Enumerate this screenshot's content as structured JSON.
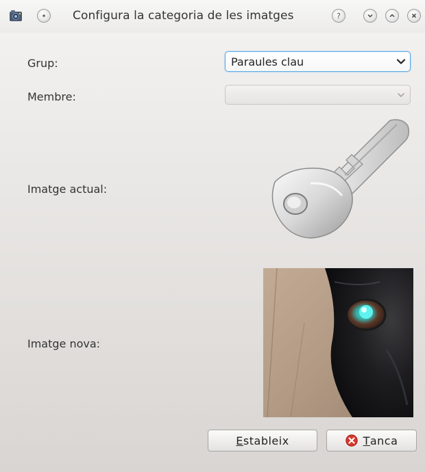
{
  "window": {
    "title": "Configura la categoria de les imatges",
    "icons": [
      "app-icon",
      "sticky-icon",
      "help-icon",
      "minimize-icon",
      "maximize-icon",
      "close-icon"
    ],
    "help_glyph": "?"
  },
  "form": {
    "group_label": "Grup:",
    "group_value": "Paraules clau",
    "member_label": "Membre:",
    "member_value": "",
    "current_image_label": "Imatge actual:",
    "new_image_label": "Imatge nova:"
  },
  "buttons": {
    "set_mnemonic": "E",
    "set_rest": "stableix",
    "close_mnemonic": "T",
    "close_rest": "anca"
  },
  "colors": {
    "focus_border": "#5aa9e6",
    "close_icon_red": "#d9372b"
  }
}
